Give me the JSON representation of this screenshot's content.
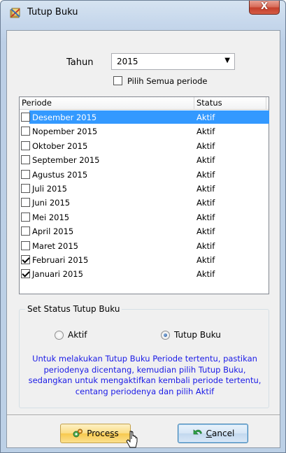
{
  "window": {
    "title": "Tutup Buku",
    "close_label": "X"
  },
  "tahun": {
    "label": "Tahun",
    "value": "2015"
  },
  "pilih_semua": {
    "label": "Pilih Semua periode",
    "checked": false
  },
  "list": {
    "columns": [
      "Periode",
      "Status"
    ],
    "rows": [
      {
        "periode": "Desember 2015",
        "status": "Aktif",
        "checked": false,
        "selected": true
      },
      {
        "periode": "Nopember 2015",
        "status": "Aktif",
        "checked": false,
        "selected": false
      },
      {
        "periode": "Oktober 2015",
        "status": "Aktif",
        "checked": false,
        "selected": false
      },
      {
        "periode": "September 2015",
        "status": "Aktif",
        "checked": false,
        "selected": false
      },
      {
        "periode": "Agustus 2015",
        "status": "Aktif",
        "checked": false,
        "selected": false
      },
      {
        "periode": "Juli 2015",
        "status": "Aktif",
        "checked": false,
        "selected": false
      },
      {
        "periode": "Juni 2015",
        "status": "Aktif",
        "checked": false,
        "selected": false
      },
      {
        "periode": "Mei 2015",
        "status": "Aktif",
        "checked": false,
        "selected": false
      },
      {
        "periode": "April 2015",
        "status": "Aktif",
        "checked": false,
        "selected": false
      },
      {
        "periode": "Maret 2015",
        "status": "Aktif",
        "checked": false,
        "selected": false
      },
      {
        "periode": "Februari 2015",
        "status": "Aktif",
        "checked": true,
        "selected": false
      },
      {
        "periode": "Januari 2015",
        "status": "Aktif",
        "checked": true,
        "selected": false
      }
    ]
  },
  "status_group": {
    "title": "Set Status Tutup Buku",
    "option_aktif": "Aktif",
    "option_tutup": "Tutup Buku",
    "selected": "Tutup Buku",
    "info": "Untuk melakukan Tutup Buku Periode tertentu, pastikan periodenya dicentang, kemudian pilih Tutup Buku, sedangkan untuk mengaktifkan kembali periode tertentu, centang periodenya dan pilih Aktif"
  },
  "buttons": {
    "process_pre": "Proce",
    "process_u": "s",
    "process_post": "s",
    "cancel_u": "C",
    "cancel_post": "ancel"
  },
  "colors": {
    "selection": "#3399ff",
    "info_text": "#1a1ae6"
  }
}
